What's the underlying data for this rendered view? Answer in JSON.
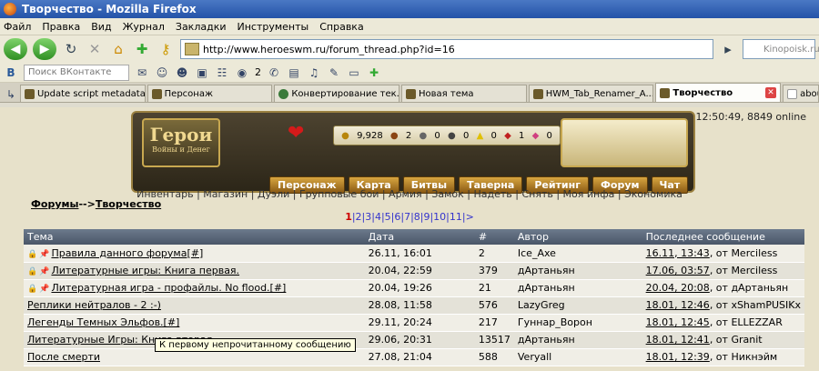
{
  "window": {
    "title": "Творчество - Mozilla Firefox"
  },
  "menu": [
    "Файл",
    "Правка",
    "Вид",
    "Журнал",
    "Закладки",
    "Инструменты",
    "Справка"
  ],
  "nav": {
    "url": "http://www.heroeswm.ru/forum_thread.php?id=16",
    "search_placeholder": "Kinopoisk.ru"
  },
  "bookmarks": {
    "vk_placeholder": "Поиск ВКонтакте",
    "badge": "2"
  },
  "tabs": [
    {
      "label": "Update script metadata..."
    },
    {
      "label": "Персонаж"
    },
    {
      "label": "Конвертирование тек..."
    },
    {
      "label": "Новая тема"
    },
    {
      "label": "HWM_Tab_Renamer_A..."
    },
    {
      "label": "Творчество"
    },
    {
      "label": "abou"
    }
  ],
  "game": {
    "clock": "12:50:49, 8849 online",
    "logo_title": "Герои",
    "logo_subtitle": "Войны и Денег",
    "resources": [
      "9,928",
      "2",
      "0",
      "0",
      "0",
      "1",
      "0"
    ],
    "main_nav": [
      "Персонаж",
      "Карта",
      "Битвы",
      "Таверна",
      "Рейтинг",
      "Форум",
      "Чат"
    ],
    "sub_nav": "Инвентарь | Магазин | Дуэли | Групповые бои | Армия | Замок | Надеть | Снять | Моя инфа | Экономика"
  },
  "breadcrumb": {
    "forums": "Форумы",
    "sep": "-->",
    "current": "Творчество"
  },
  "pager": {
    "current": "1",
    "pages": "|2|3|4|5|6|7|8|9|10|11|>"
  },
  "table": {
    "headers": [
      "Тема",
      "Дата",
      "#",
      "Автор",
      "Последнее сообщение"
    ],
    "rows": [
      {
        "topic": "Правила данного форума[#]",
        "date": "26.11, 16:01",
        "count": "2",
        "author": "Ice_Axe",
        "last": "16.11, 13:43",
        "last_by": ", от Merciless"
      },
      {
        "topic": "Литературные игры: Книга первая.",
        "date": "20.04, 22:59",
        "count": "379",
        "author": "дАртаньян",
        "last": "17.06, 03:57",
        "last_by": ", от Merciless"
      },
      {
        "topic": "Литературная игра - профайлы. No flood.[#]",
        "date": "20.04, 19:26",
        "count": "21",
        "author": "дАртаньян",
        "last": "20.04, 20:08",
        "last_by": ", от дАртаньян"
      },
      {
        "topic": "Реплики нейтралов - 2 :-)",
        "date": "28.08, 11:58",
        "count": "576",
        "author": "LazyGreg",
        "last": "18.01, 12:46",
        "last_by": ", от xShamPUSIKx"
      },
      {
        "topic": "Легенды Темных Эльфов.[#]",
        "date": "29.11, 20:24",
        "count": "217",
        "author": "Гуннар_Ворон",
        "last": "18.01, 12:45",
        "last_by": ", от ELLEZZAR"
      },
      {
        "topic": "Литературные Игры: Книга вторая",
        "date": "29.06, 20:31",
        "count": "13517",
        "author": "дАртаньян",
        "last": "18.01, 12:41",
        "last_by": ", от Granit"
      },
      {
        "topic": "После смерти",
        "date": "27.08, 21:04",
        "count": "588",
        "author": "Veryall",
        "last": "18.01, 12:39",
        "last_by": ", от Никнэйм"
      }
    ]
  },
  "tooltip": "К первому непрочитанному сообщению"
}
